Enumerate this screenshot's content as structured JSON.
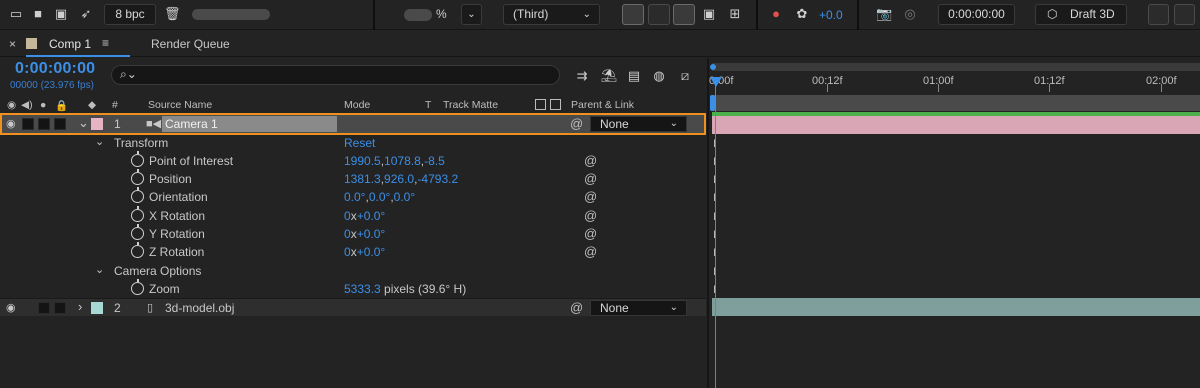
{
  "toolbar": {
    "bit_depth": "8 bpc",
    "zoom_label": "%",
    "view_select": "(Third)",
    "exposure_value": "+0.0",
    "time_display": "0:00:00:00",
    "renderer": "Draft 3D"
  },
  "tabs": {
    "comp_tab": "Comp 1",
    "menu_glyph": "≡",
    "render_queue": "Render Queue",
    "close_glyph": "×"
  },
  "timeline": {
    "current_time": "0:00:00:00",
    "frame_info": "00000 (23.976 fps)",
    "search_glyph": "⌕⌄"
  },
  "columns": {
    "number": "#",
    "source_name": "Source Name",
    "mode": "Mode",
    "t": "T",
    "track_matte": "Track Matte",
    "parent_link": "Parent & Link"
  },
  "layers": [
    {
      "index": "1",
      "name": "Camera 1",
      "parent": "None",
      "label_color": "#e8b4c4"
    },
    {
      "index": "2",
      "name": "3d-model.obj",
      "parent": "None",
      "label_color": "#a8d8d4"
    }
  ],
  "transform": {
    "group": "Transform",
    "reset": "Reset",
    "props": [
      {
        "name": "Point of Interest",
        "value_a": "1990.5",
        "sep_a": ",",
        "value_b": "1078.8",
        "sep_b": ",",
        "value_c": "-8.5"
      },
      {
        "name": "Position",
        "value_a": "1381.3",
        "sep_a": ",",
        "value_b": "926.0",
        "sep_b": ",",
        "value_c": "-4793.2"
      },
      {
        "name": "Orientation",
        "value_a": "0.0°",
        "sep_a": ",",
        "value_b": "0.0°",
        "sep_b": ",",
        "value_c": "0.0°"
      },
      {
        "name": "X Rotation",
        "value_a": "0",
        "sep_a": "x",
        "value_b": "+0.0°"
      },
      {
        "name": "Y Rotation",
        "value_a": "0",
        "sep_a": "x",
        "value_b": "+0.0°"
      },
      {
        "name": "Z Rotation",
        "value_a": "0",
        "sep_a": "x",
        "value_b": "+0.0°"
      }
    ]
  },
  "camera_options": {
    "group": "Camera Options",
    "zoom_label": "Zoom",
    "zoom_value": "5333.3",
    "zoom_suffix": " pixels (39.6° H)"
  },
  "ruler": {
    "labels": [
      "0:00f",
      "00:12f",
      "01:00f",
      "01:12f",
      "02:00f"
    ]
  },
  "glyphs": {
    "eye": "👁",
    "spiral": "@",
    "chevron": "⌄",
    "expand_open": "⌄",
    "expand_closed": "›",
    "keyframe": "I"
  },
  "colors": {
    "accent": "#3c8fe6",
    "selection_outline": "#f0901e",
    "camera_bar": "#d9a6b6",
    "model_bar": "#7f9f9d"
  }
}
